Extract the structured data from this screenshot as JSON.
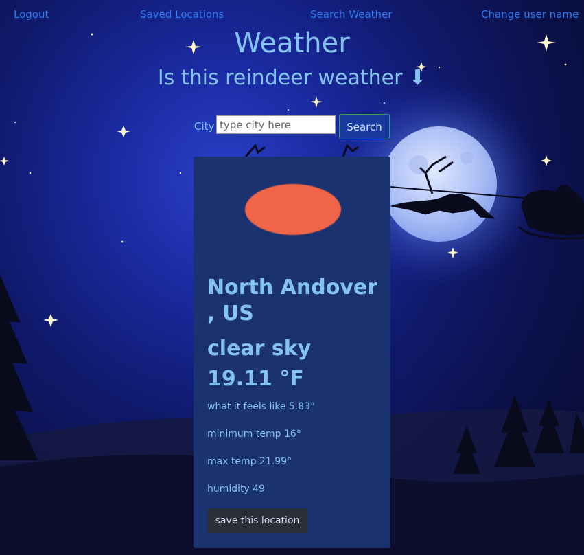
{
  "nav": {
    "logout": "Logout",
    "saved_locations": "Saved Locations",
    "search_weather": "Search Weather",
    "change_user_name": "Change user name"
  },
  "header": {
    "title": "Weather",
    "subtitle": "Is this reindeer weather ⬇"
  },
  "search": {
    "label": "City",
    "placeholder": "type city here",
    "value": "",
    "button": "Search"
  },
  "weather": {
    "icon": "sun-icon",
    "location": "North Andover , US",
    "description": "clear sky",
    "temperature": "19.11 °F",
    "feels_like": "what it feels like 5.83°",
    "min_temp": "minimum temp 16°",
    "max_temp": "max temp 21.99°",
    "humidity": "humidity 49",
    "save_button": "save this location"
  },
  "colors": {
    "accent_text": "#84c3ee",
    "link": "#2f7cf0",
    "card_bg": "#1b3270",
    "sun": "#ef6548"
  }
}
